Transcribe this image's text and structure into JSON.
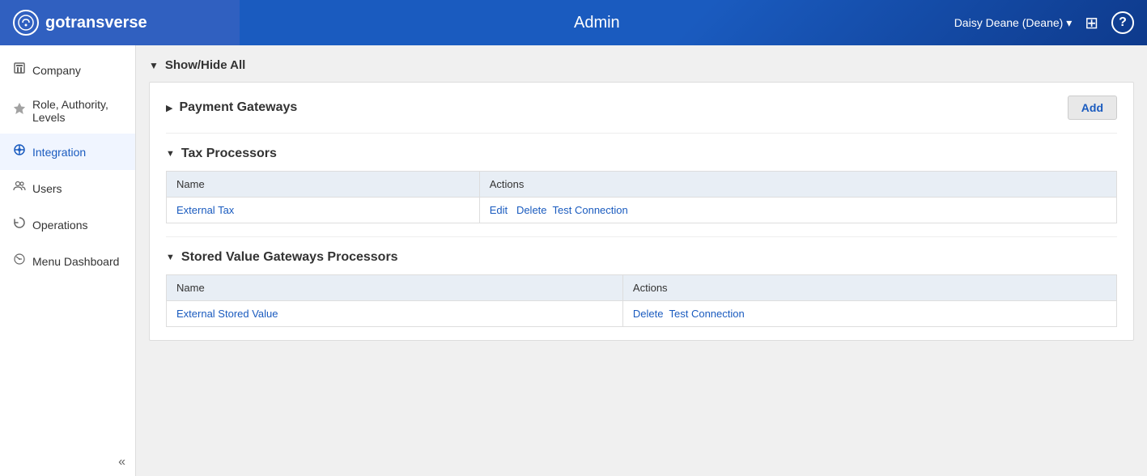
{
  "header": {
    "logo_text": "gotransverse",
    "logo_initial": "G",
    "title": "Admin",
    "user": "Daisy Deane (Deane)",
    "user_dropdown_arrow": "▾",
    "grid_icon": "⊞",
    "help_icon": "?"
  },
  "sidebar": {
    "items": [
      {
        "id": "company",
        "label": "Company",
        "icon": "🏢",
        "active": false
      },
      {
        "id": "role-authority-levels",
        "label": "Role, Authority, Levels",
        "icon": "🛡",
        "active": false
      },
      {
        "id": "integration",
        "label": "Integration",
        "icon": "⚙",
        "active": true
      },
      {
        "id": "users",
        "label": "Users",
        "icon": "👥",
        "active": false
      },
      {
        "id": "operations",
        "label": "Operations",
        "icon": "↻",
        "active": false
      },
      {
        "id": "menu-dashboard",
        "label": "Menu Dashboard",
        "icon": "📊",
        "active": false
      }
    ],
    "collapse_label": "«"
  },
  "main": {
    "show_hide_all_label": "Show/Hide All",
    "show_hide_arrow": "▼",
    "sections": [
      {
        "id": "payment-gateways",
        "title": "Payment Gateways",
        "arrow": "▶",
        "add_button": "Add",
        "has_table": false
      },
      {
        "id": "tax-processors",
        "title": "Tax Processors",
        "arrow": "▼",
        "has_table": true,
        "columns": [
          "Name",
          "Actions"
        ],
        "rows": [
          {
            "name": "External Tax",
            "actions": [
              "Edit",
              "Delete",
              "Test Connection"
            ]
          }
        ]
      },
      {
        "id": "stored-value-gateways",
        "title": "Stored Value Gateways Processors",
        "arrow": "▼",
        "has_table": true,
        "columns": [
          "Name",
          "Actions"
        ],
        "rows": [
          {
            "name": "External Stored Value",
            "actions": [
              "Delete",
              "Test Connection"
            ]
          }
        ]
      }
    ]
  }
}
